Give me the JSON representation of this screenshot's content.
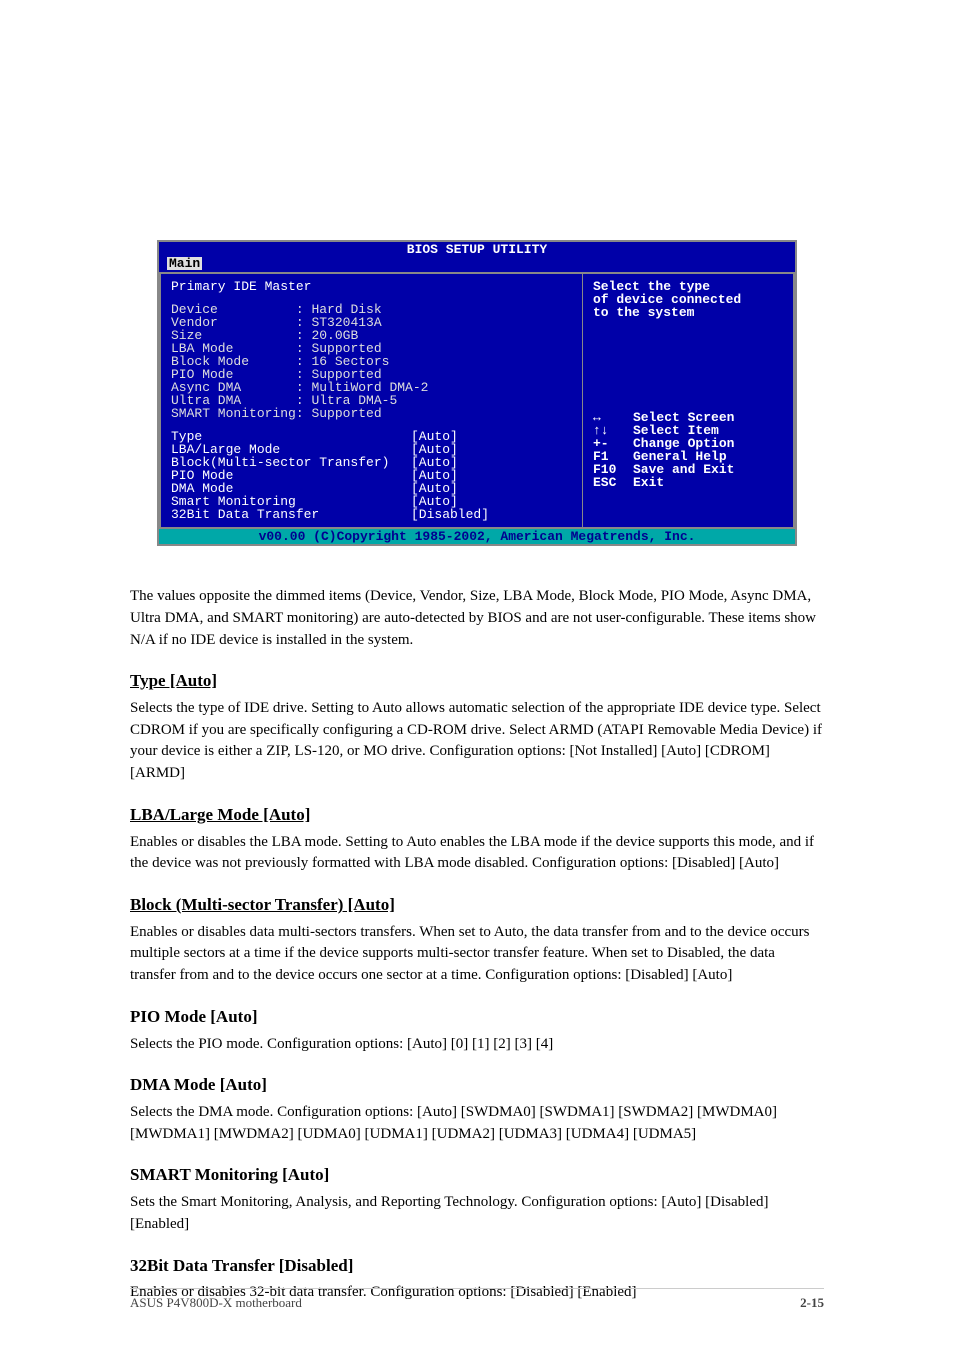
{
  "bios": {
    "title": "BIOS SETUP UTILITY",
    "tab": "Main",
    "pane_title": "Primary IDE Master",
    "info": [
      {
        "label": "Device",
        "value": "Hard Disk"
      },
      {
        "label": "Vendor",
        "value": "ST320413A"
      },
      {
        "label": "Size",
        "value": "20.0GB"
      },
      {
        "label": "LBA Mode",
        "value": "Supported"
      },
      {
        "label": "Block Mode",
        "value": "16 Sectors"
      },
      {
        "label": "PIO Mode",
        "value": "Supported"
      },
      {
        "label": "Async DMA",
        "value": "MultiWord DMA-2"
      },
      {
        "label": "Ultra DMA",
        "value": "Ultra DMA-5"
      },
      {
        "label": "SMART Monitoring",
        "value": "Supported"
      }
    ],
    "options": [
      {
        "label": "Type",
        "value": "[Auto]"
      },
      {
        "label": "LBA/Large Mode",
        "value": "[Auto]"
      },
      {
        "label": "Block(Multi-sector Transfer)",
        "value": "[Auto]"
      },
      {
        "label": "PIO Mode",
        "value": "[Auto]"
      },
      {
        "label": "DMA Mode",
        "value": "[Auto]"
      },
      {
        "label": "Smart Monitoring",
        "value": "[Auto]"
      },
      {
        "label": "32Bit Data Transfer",
        "value": "[Disabled]"
      }
    ],
    "help": "Select the type\nof device connected\nto the system",
    "nav": [
      {
        "key": "↔",
        "label": "Select Screen"
      },
      {
        "key": "↑↓",
        "label": "Select Item"
      },
      {
        "key": "+-",
        "label": "Change Option"
      },
      {
        "key": "F1",
        "label": "General Help"
      },
      {
        "key": "F10",
        "label": "Save and Exit"
      },
      {
        "key": "ESC",
        "label": "Exit"
      }
    ],
    "footer": "v00.00 (C)Copyright 1985-2002, American Megatrends, Inc."
  },
  "doc": {
    "lead_para": "The values opposite the dimmed items (Device, Vendor, Size, LBA Mode, Block Mode, PIO Mode, Async DMA, Ultra DMA, and SMART monitoring) are auto-detected by BIOS and are not user-configurable. These items show N/A if no IDE device is installed in the system.",
    "type_heading": "Type [Auto]",
    "type_p1": "Selects the type of IDE drive. Setting to Auto allows automatic selection of the appropriate IDE device type. Select CDROM if you are specifically configuring a CD-ROM drive. Select ARMD (ATAPI Removable Media Device) if your device is either a ZIP, LS-120, or MO drive. Configuration options: [Not Installed] [Auto] [CDROM] [ARMD]",
    "lba_heading": "LBA/Large Mode [Auto]",
    "lba_p1": "Enables or disables the LBA mode. Setting to Auto enables the LBA mode if the device supports this mode, and if the device was not previously formatted with LBA mode disabled. Configuration options: [Disabled] [Auto]",
    "block_heading": "Block (Multi-sector Transfer) [Auto]",
    "block_p1": "Enables or disables data multi-sectors transfers. When set to Auto, the data transfer from and to the device occurs multiple sectors at a time if the device supports multi-sector transfer feature. When set to Disabled, the data transfer from and to the device occurs one sector at a time. Configuration options: [Disabled] [Auto]",
    "pio_heading": "PIO Mode [Auto]",
    "pio_p1": "Selects the PIO mode. Configuration options: [Auto] [0] [1] [2] [3] [4]",
    "dma_heading": "DMA Mode [Auto]",
    "dma_p1": "Selects the DMA mode. Configuration options: [Auto] [SWDMA0] [SWDMA1] [SWDMA2] [MWDMA0] [MWDMA1] [MWDMA2] [UDMA0] [UDMA1] [UDMA2] [UDMA3] [UDMA4] [UDMA5]",
    "smart_heading": "SMART Monitoring [Auto]",
    "smart_p1": "Sets the Smart Monitoring, Analysis, and Reporting Technology. Configuration options: [Auto] [Disabled] [Enabled]",
    "xfer_heading": "32Bit Data Transfer [Disabled]",
    "xfer_p1": "Enables or disables 32-bit data transfer. Configuration options: [Disabled] [Enabled]"
  },
  "footer": {
    "left": "ASUS P4V800D-X motherboard",
    "right": "2-15"
  }
}
